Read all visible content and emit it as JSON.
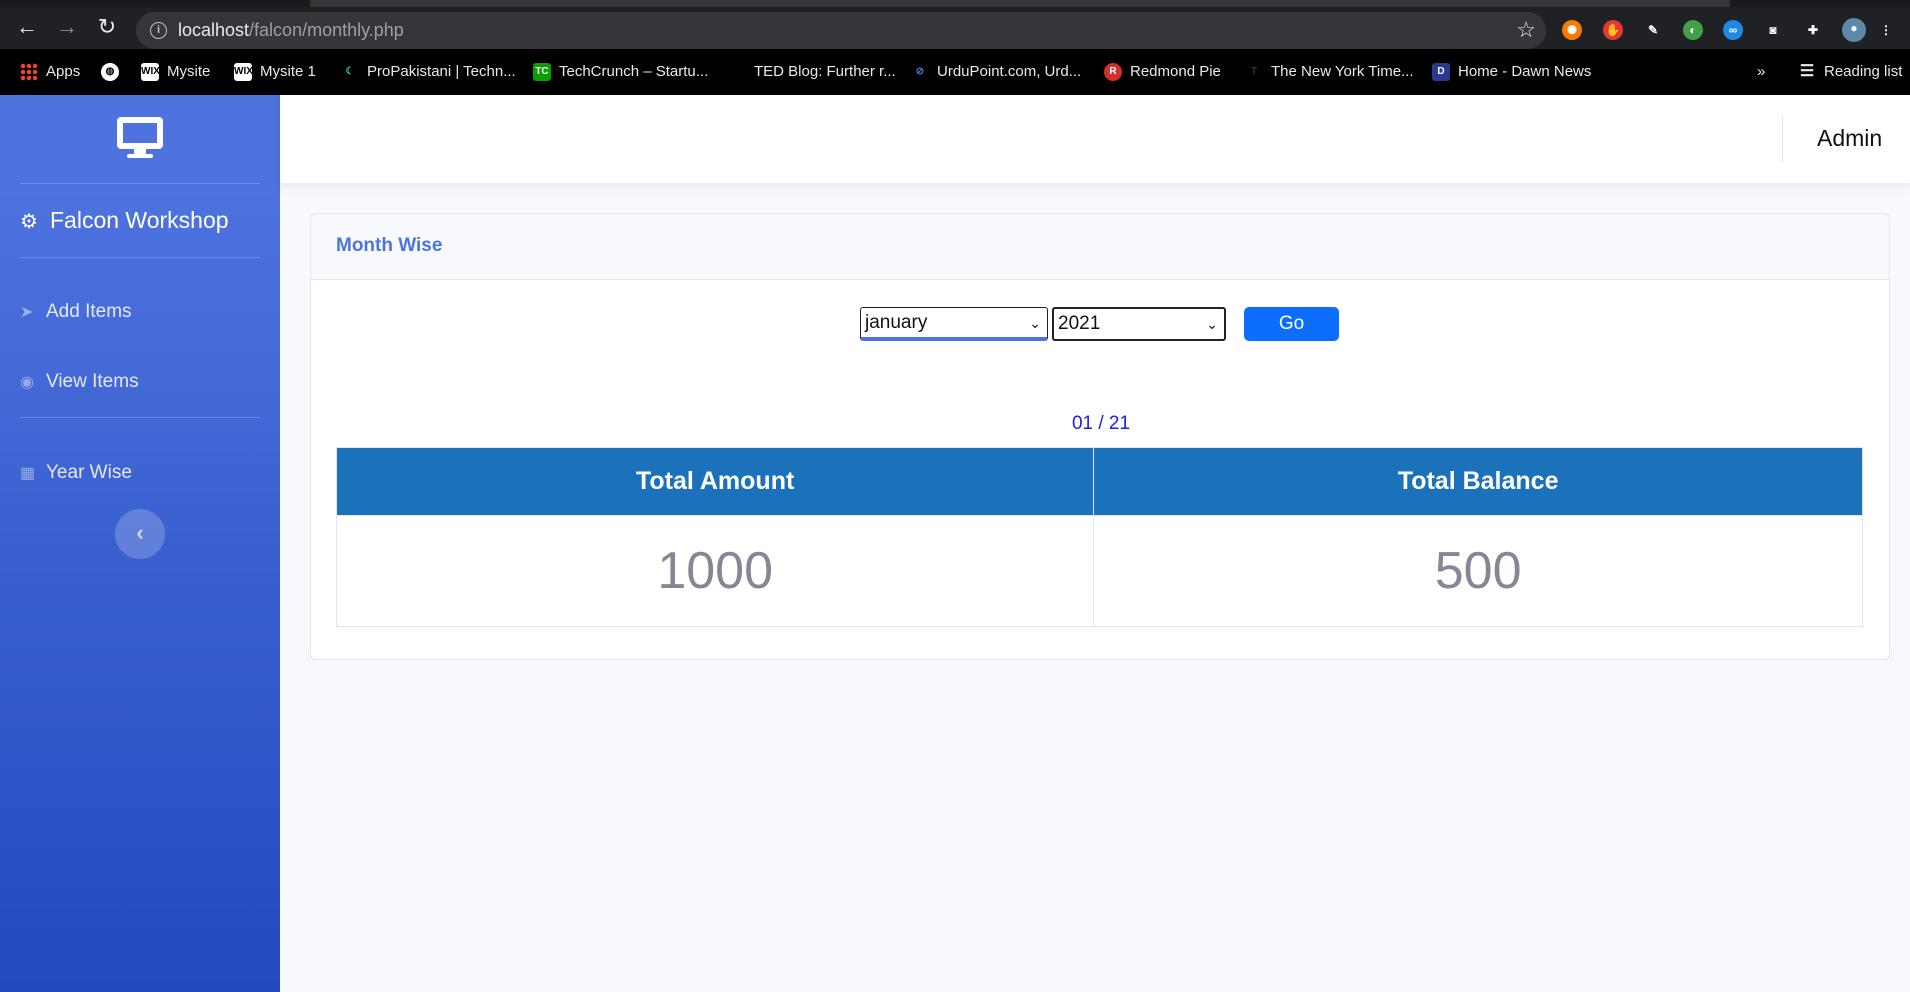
{
  "browser": {
    "url_host": "localhost",
    "url_path": "/falcon/monthly.php",
    "bookmarks": [
      {
        "label": "Apps",
        "icon": "apps-grid-icon"
      },
      {
        "label": "",
        "icon": "globe-icon"
      },
      {
        "label": "Mysite",
        "icon": "wix-icon"
      },
      {
        "label": "Mysite 1",
        "icon": "wix-icon"
      },
      {
        "label": "ProPakistani | Techn...",
        "icon": "propakistani-icon"
      },
      {
        "label": "TechCrunch – Startu...",
        "icon": "techcrunch-icon"
      },
      {
        "label": "TED Blog: Further r...",
        "icon": "ted-icon"
      },
      {
        "label": "UrduPoint.com, Urd...",
        "icon": "urdupoint-icon"
      },
      {
        "label": "Redmond Pie",
        "icon": "redmond-pie-icon"
      },
      {
        "label": "The New York Time...",
        "icon": "nyt-icon"
      },
      {
        "label": "Home - Dawn News",
        "icon": "dawn-icon"
      }
    ],
    "more_label": "»",
    "reading_list": "Reading list"
  },
  "sidebar": {
    "brand": "Falcon Workshop",
    "items": [
      {
        "label": "Add Items",
        "icon": "paper-plane-icon"
      },
      {
        "label": "View Items",
        "icon": "eye-icon"
      },
      {
        "label": "Year Wise",
        "icon": "calculator-icon"
      }
    ],
    "toggle_label": "‹"
  },
  "topbar": {
    "user": "Admin"
  },
  "card": {
    "title": "Month Wise",
    "month_selected": "january",
    "year_selected": "2021",
    "go_label": "Go",
    "period": "01 / 21",
    "columns": [
      "Total Amount",
      "Total Balance"
    ],
    "values": [
      "1000",
      "500"
    ]
  },
  "colors": {
    "sidebar_gradient_top": "#4e73df",
    "sidebar_gradient_bottom": "#224abe",
    "table_header": "#1b72bb",
    "go_button": "#0d6efd",
    "title_accent": "#4e73df"
  }
}
